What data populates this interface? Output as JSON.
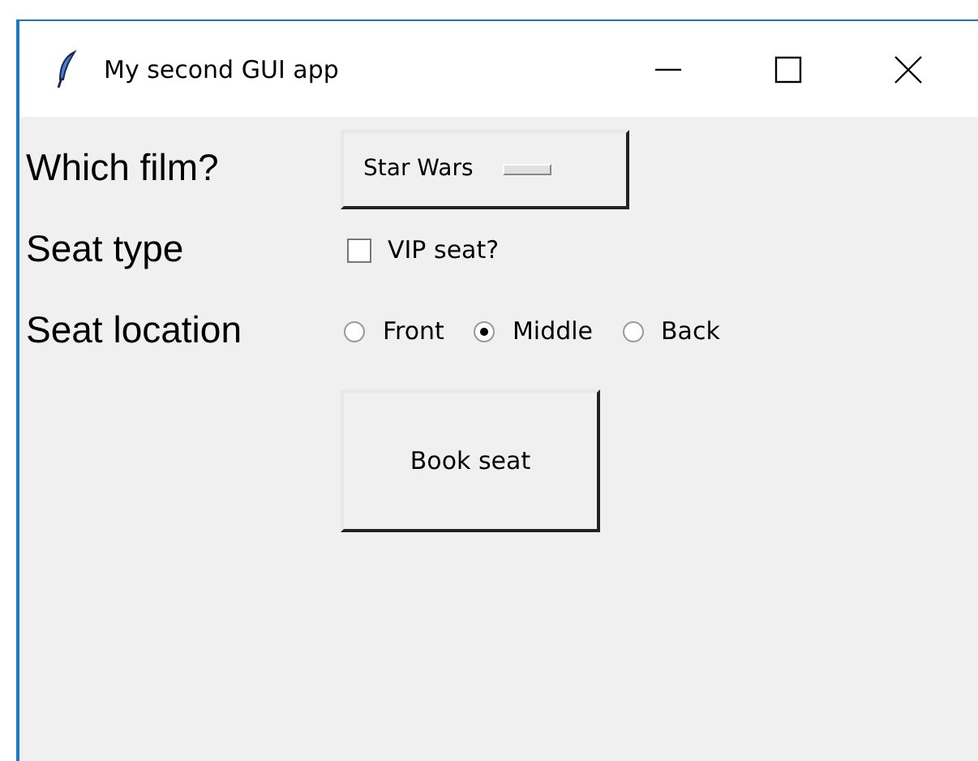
{
  "window": {
    "title": "My second GUI app"
  },
  "rows": [
    {
      "label": "Which film?",
      "kind": "option_menu",
      "value": "Star Wars"
    },
    {
      "label": "Seat type",
      "kind": "checkbox",
      "text": "VIP seat?",
      "checked": false
    },
    {
      "label": "Seat location",
      "kind": "radio_group",
      "options": [
        {
          "label": "Front",
          "selected": false
        },
        {
          "label": "Middle",
          "selected": true
        },
        {
          "label": "Back",
          "selected": false
        }
      ]
    }
  ],
  "buttons": [
    "Book seat"
  ]
}
